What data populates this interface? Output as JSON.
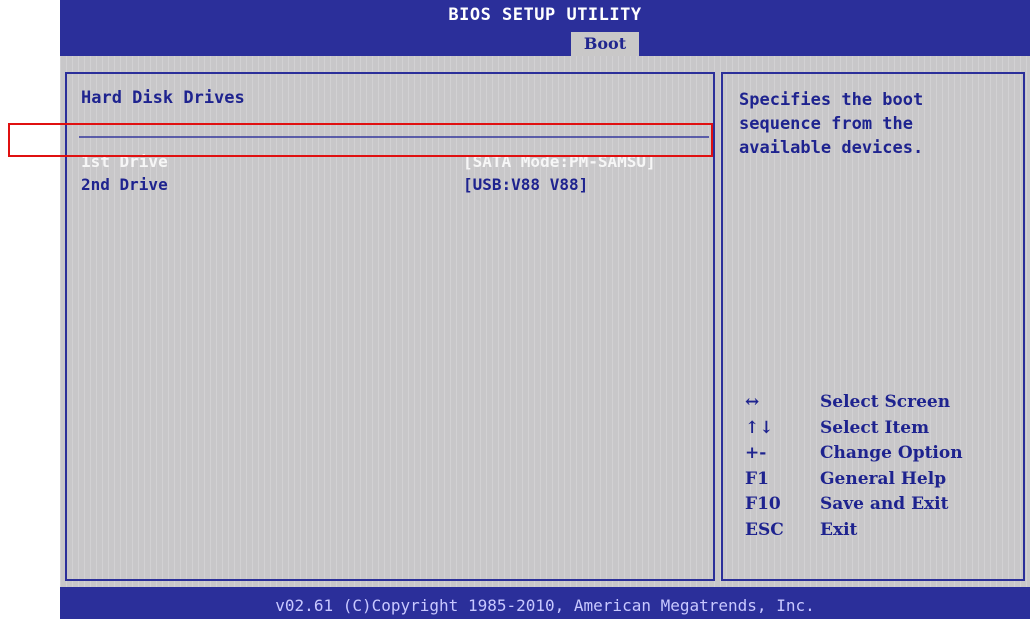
{
  "bios": {
    "title": "BIOS SETUP UTILITY",
    "active_tab": "Boot"
  },
  "main": {
    "section_title": "Hard Disk Drives",
    "rows": [
      {
        "label": "1st Drive",
        "value": "[SATA Mode:PM-SAMSU]",
        "selected": true
      },
      {
        "label": "2nd Drive",
        "value": "[USB:V88 V88]",
        "selected": false
      }
    ]
  },
  "help": {
    "text": "Specifies the boot sequence from the available devices.",
    "keys": [
      {
        "key": "↔",
        "desc": "Select Screen",
        "icon": "left-right-arrows-icon"
      },
      {
        "key": "↑↓",
        "desc": "Select Item",
        "icon": "up-down-arrows-icon"
      },
      {
        "key": "+-",
        "desc": "Change Option",
        "icon": "plus-minus-icon"
      },
      {
        "key": "F1",
        "desc": "General Help"
      },
      {
        "key": "F10",
        "desc": "Save and Exit"
      },
      {
        "key": "ESC",
        "desc": "Exit"
      }
    ]
  },
  "footer": {
    "copyright": "v02.61 (C)Copyright 1985-2010, American Megatrends, Inc."
  },
  "colors": {
    "bios_blue": "#2b2f9a",
    "panel_gray": "#c8c7c9",
    "text_blue": "#1e238f",
    "annotation_red": "#e01010"
  }
}
